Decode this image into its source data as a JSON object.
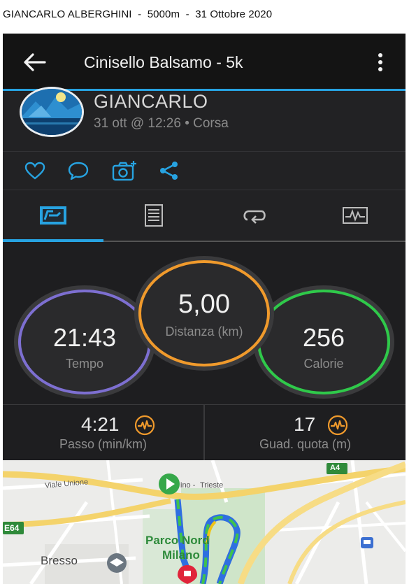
{
  "caption": "GIANCARLO ALBERGHINI  -  5000m  -  31 Ottobre 2020",
  "colors": {
    "accent": "#27a3e1",
    "time_ring": "#7d6fd1",
    "distance_ring": "#f09a2c",
    "calories_ring": "#2fc94a",
    "badge": "#f09a2c"
  },
  "appbar": {
    "back_icon": "arrow-left-icon",
    "title": "Cinisello Balsamo - 5k",
    "more_icon": "more-vertical-icon"
  },
  "profile": {
    "name": "GIANCARLO",
    "meta": "31 ott @ 12:26 • Corsa"
  },
  "actions": [
    "heart-icon",
    "comment-icon",
    "add-photo-icon",
    "share-icon"
  ],
  "tabs": [
    {
      "icon": "stats-icon",
      "selected": true
    },
    {
      "icon": "details-icon",
      "selected": false
    },
    {
      "icon": "laps-icon",
      "selected": false
    },
    {
      "icon": "chart-icon",
      "selected": false
    }
  ],
  "summary": {
    "time": {
      "value": "21:43",
      "label": "Tempo"
    },
    "distance": {
      "value": "5,00",
      "label": "Distanza (km)"
    },
    "calories": {
      "value": "256",
      "label": "Calorie"
    }
  },
  "stats": {
    "pace": {
      "value": "4:21",
      "label": "Passo (min/km)"
    },
    "elevation": {
      "value": "17",
      "label": "Guad. quota (m)"
    }
  },
  "map": {
    "road_viale_unione": "Viale Unione",
    "road_trieste": "Trieste",
    "road_partial": "ino -",
    "highway_a4": "A4",
    "highway_e64": "E64",
    "park": "Parco Nord",
    "city_milano": "Milano",
    "town_bresso": "Bresso"
  }
}
